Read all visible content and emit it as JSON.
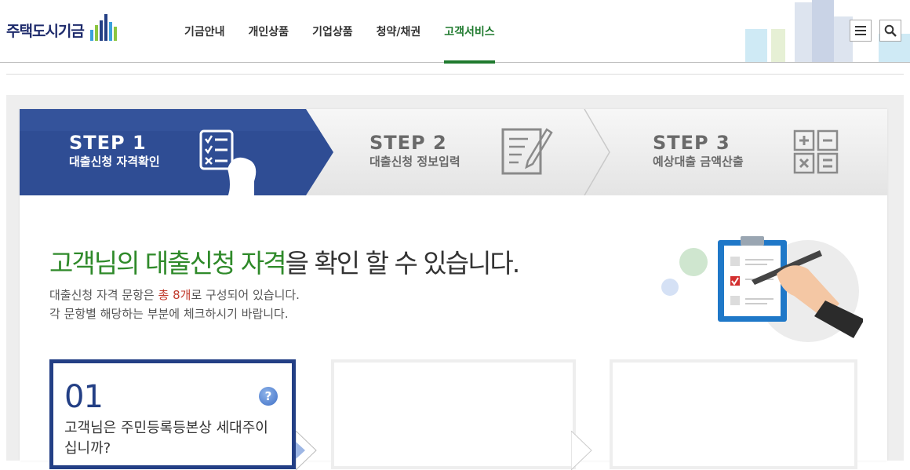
{
  "header": {
    "logo_text": "주택도시기금",
    "nav": [
      "기금안내",
      "개인상품",
      "기업상품",
      "청약/채권",
      "고객서비스"
    ],
    "active_nav_index": 4,
    "menu_icon": "hamburger-menu-icon",
    "search_icon": "search-icon"
  },
  "steps": [
    {
      "label": "STEP 1",
      "desc": "대출신청 자격확인",
      "icon": "checklist-person-icon",
      "active": true
    },
    {
      "label": "STEP 2",
      "desc": "대출신청 정보입력",
      "icon": "document-edit-icon",
      "active": false
    },
    {
      "label": "STEP 3",
      "desc": "예상대출 금액산출",
      "icon": "calculator-icon",
      "active": false
    }
  ],
  "headline": {
    "highlight": "고객님의 대출신청 자격",
    "rest": "을 확인 할 수 있습니다."
  },
  "description": {
    "line1_prefix": "대출신청 자격 문항은 ",
    "line1_count": "총 8개",
    "line1_suffix": "로 구성되어 있습니다.",
    "line2": "각 문항별 해당하는 부분에 체크하시기 바랍니다."
  },
  "questions": [
    {
      "number": "01",
      "text": "고객님은 주민등록등본상 세대주이십니까?",
      "help_icon": "question-help-icon"
    }
  ],
  "colors": {
    "navy": "#233f85",
    "green": "#2f8a2a",
    "nav_active": "#1f7a2e",
    "red": "#c0392b"
  }
}
